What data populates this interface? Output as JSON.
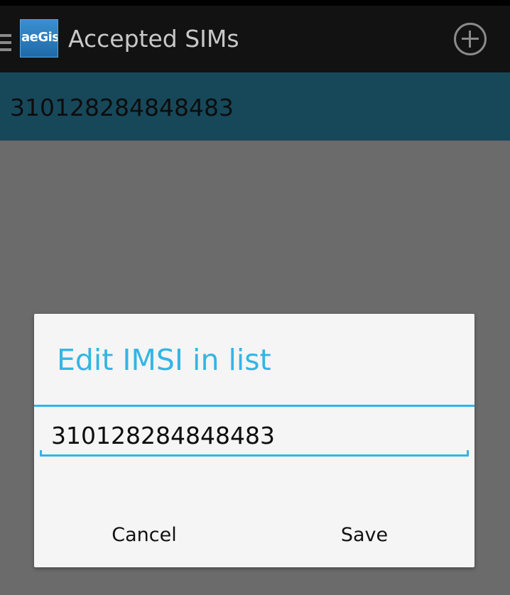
{
  "action_bar": {
    "logo_text": "aeGis",
    "title": "Accepted SIMs",
    "drawer_icon": "menu-icon",
    "add_icon": "add-circle-icon"
  },
  "list": {
    "items": [
      {
        "label": "310128284848483"
      }
    ]
  },
  "dialog": {
    "title": "Edit IMSI in list",
    "input_value": "310128284848483",
    "cancel_label": "Cancel",
    "save_label": "Save"
  },
  "colors": {
    "accent": "#33b5e5",
    "action_bar_bg": "#121212",
    "list_item_bg": "#17485a",
    "scrim_bg": "#6b6b6b",
    "dialog_bg": "#f5f5f5"
  }
}
